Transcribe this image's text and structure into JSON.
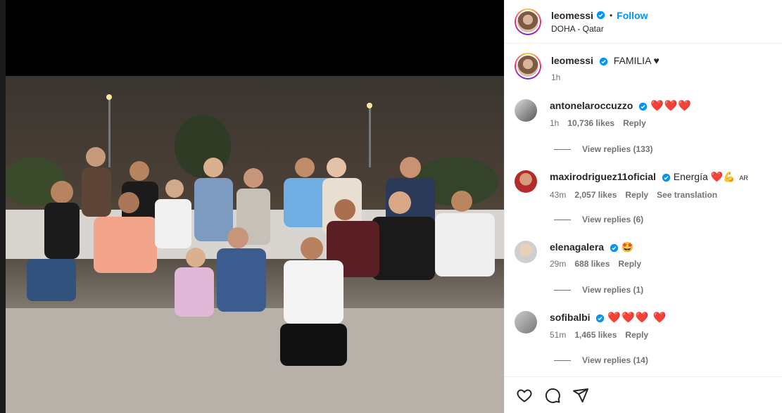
{
  "post": {
    "username": "leomessi",
    "dot": "•",
    "follow_label": "Follow",
    "location": "DOHA - Qatar",
    "caption": "FAMILIA ♥",
    "time": "1h"
  },
  "comments": [
    {
      "username": "antonelaroccuzzo",
      "text": "❤️❤️❤️",
      "time": "1h",
      "likes": "10,736 likes",
      "reply": "Reply",
      "view_replies": "View replies (133)"
    },
    {
      "username": "maxirodriguez11oficial",
      "text": "Energía ❤️💪",
      "flag": "AR",
      "time": "43m",
      "likes": "2,057 likes",
      "reply": "Reply",
      "translation": "See translation",
      "view_replies": "View replies (6)"
    },
    {
      "username": "elenagalera",
      "text": "🤩",
      "time": "29m",
      "likes": "688 likes",
      "reply": "Reply",
      "view_replies": "View replies (1)"
    },
    {
      "username": "sofibalbi",
      "text": "❤️❤️❤️ ❤️",
      "time": "51m",
      "likes": "1,465 likes",
      "reply": "Reply",
      "view_replies": "View replies (14)"
    }
  ],
  "colors": {
    "accent": "#0095f6",
    "verified": "#0095f6",
    "muted": "#737373"
  },
  "icons": [
    "heart-outline-icon",
    "comment-icon",
    "share-icon",
    "verified-icon"
  ]
}
